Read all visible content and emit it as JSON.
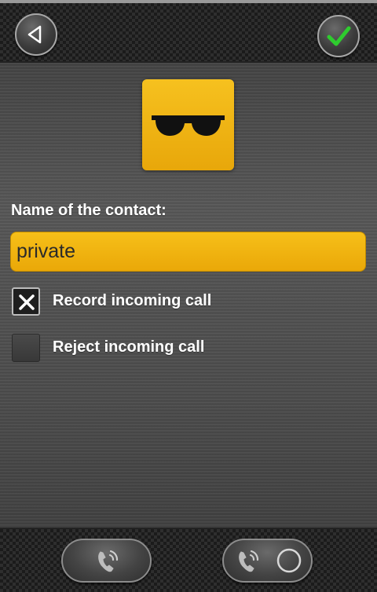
{
  "header": {
    "back_icon": "triangle-left-icon",
    "confirm_icon": "checkmark-icon",
    "confirm_color": "#2ecc2e"
  },
  "contact": {
    "avatar_icon": "sunglasses-icon",
    "avatar_color": "#f2b714",
    "label": "Name of the contact:",
    "name_value": "private"
  },
  "options": [
    {
      "label": "Record incoming call",
      "checked": true
    },
    {
      "label": "Reject incoming call",
      "checked": false
    }
  ],
  "footer": {
    "left_button_icon": "phone-ringing-icon",
    "right_button_icons": [
      "phone-ringing-icon",
      "record-circle-icon"
    ]
  }
}
